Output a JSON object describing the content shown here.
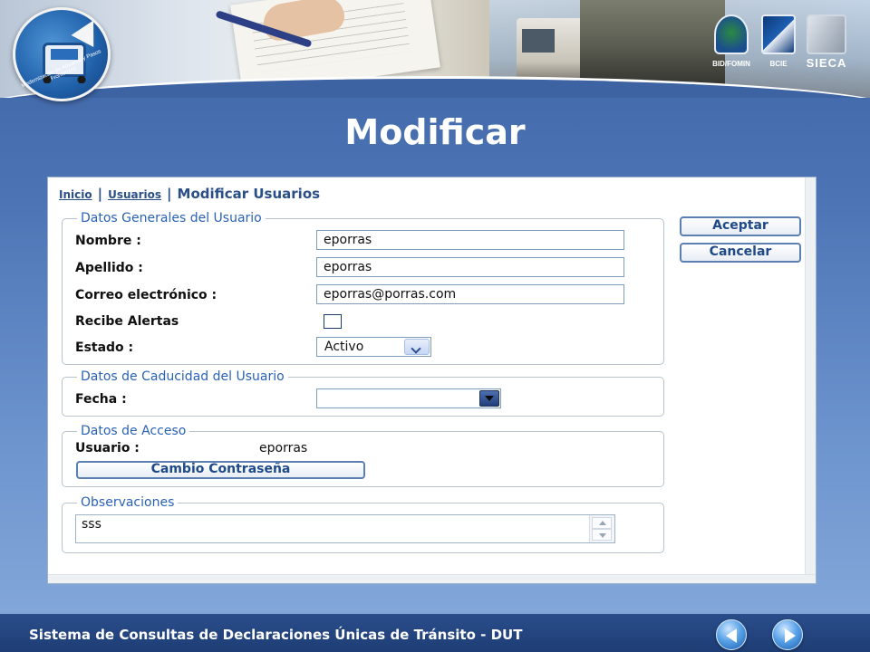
{
  "banner": {
    "logo_text": "Modernización de Aduanas y Pasos Fronterizos",
    "sponsors": [
      "BID/FOMIN",
      "BCIE",
      "SIECA"
    ]
  },
  "slide": {
    "title": "Modificar",
    "footer": "Sistema de Consultas de Declaraciones Únicas de Tránsito - DUT"
  },
  "breadcrumb": {
    "home": "Inicio",
    "separator": "|",
    "users": "Usuarios",
    "current": "Modificar Usuarios"
  },
  "actions": {
    "accept": "Aceptar",
    "cancel": "Cancelar"
  },
  "general": {
    "legend": "Datos Generales del Usuario",
    "name_label": "Nombre :",
    "name_value": "eporras",
    "lastname_label": "Apellido :",
    "lastname_value": "eporras",
    "email_label": "Correo electrónico :",
    "email_value": "eporras@porras.com",
    "alerts_label": "Recibe Alertas",
    "alerts_checked": false,
    "status_label": "Estado :",
    "status_value": "Activo"
  },
  "expiry": {
    "legend": "Datos de Caducidad del Usuario",
    "date_label": "Fecha :",
    "date_value": ""
  },
  "access": {
    "legend": "Datos de Acceso",
    "user_label": "Usuario :",
    "user_value": "eporras",
    "change_password": "Cambio Contraseña"
  },
  "notes": {
    "legend": "Observaciones",
    "value": "sss"
  },
  "colors": {
    "background": "#4c74b5",
    "accent": "#2a62b4",
    "footer": "#1e3d75"
  }
}
